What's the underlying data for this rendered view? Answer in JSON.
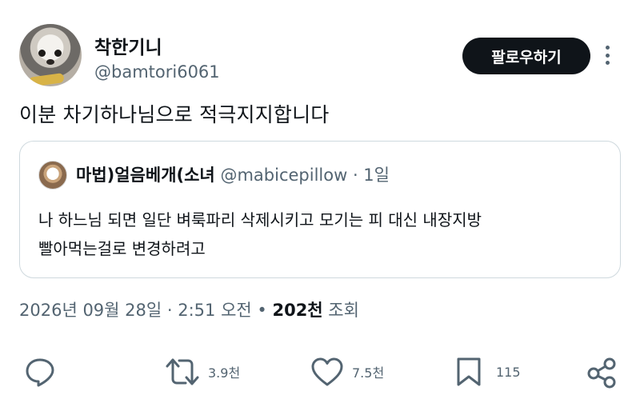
{
  "author": {
    "display_name": "착한기니",
    "handle": "@bamtori6061"
  },
  "follow_button": {
    "label": "팔로우하기"
  },
  "tweet": {
    "text": "이분 차기하나님으로 적극지지합니다"
  },
  "quoted": {
    "display_name": "마법)얼음베개(소녀",
    "handle": "@mabicepillow",
    "separator": " · ",
    "time": "1일",
    "lines": [
      "나 하느님 되면 일단 벼룩파리 삭제시키고 모기는 피 대신 내장지방",
      "빨아먹는걸로 변경하려고"
    ]
  },
  "meta": {
    "date": "2026년 09월 28일",
    "separator": " · ",
    "time": "2:51 오전",
    "bullet": " • ",
    "views_count": "202천",
    "views_label": " 조회"
  },
  "actions": {
    "reply": {
      "icon": "reply-icon"
    },
    "retweet": {
      "icon": "retweet-icon",
      "count": "3.9천"
    },
    "like": {
      "icon": "heart-icon",
      "count": "7.5천"
    },
    "bookmark": {
      "icon": "bookmark-icon",
      "count": "115"
    },
    "share": {
      "icon": "share-icon"
    }
  },
  "colors": {
    "text": "#0f1419",
    "secondary": "#536471",
    "border": "#cfd9de",
    "button_bg": "#0f1419"
  }
}
